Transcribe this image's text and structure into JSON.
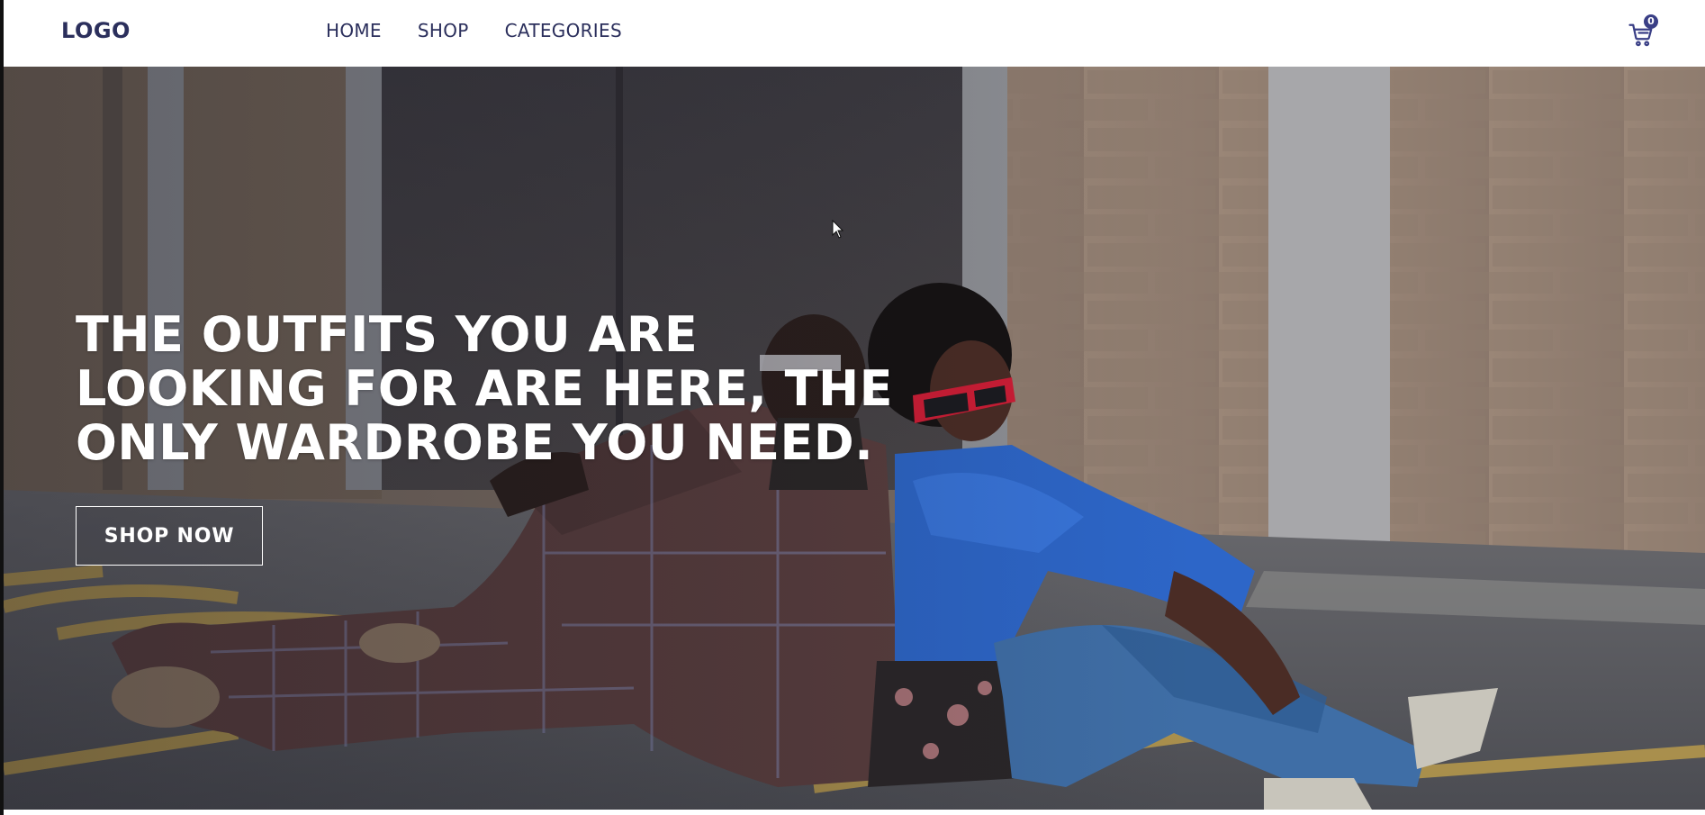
{
  "header": {
    "logo": "LOGO",
    "nav": [
      {
        "label": "HOME"
      },
      {
        "label": "SHOP"
      },
      {
        "label": "CATEGORIES"
      }
    ],
    "cart": {
      "icon": "cart-icon",
      "count": "0"
    }
  },
  "hero": {
    "title": "THE OUTFITS YOU ARE LOOKING FOR ARE HERE, THE ONLY WARDROBE YOU NEED.",
    "cta_label": "SHOP NOW"
  },
  "colors": {
    "brand": "#2b2f5c",
    "badge": "#3a3f86",
    "hero_text": "#ffffff"
  }
}
